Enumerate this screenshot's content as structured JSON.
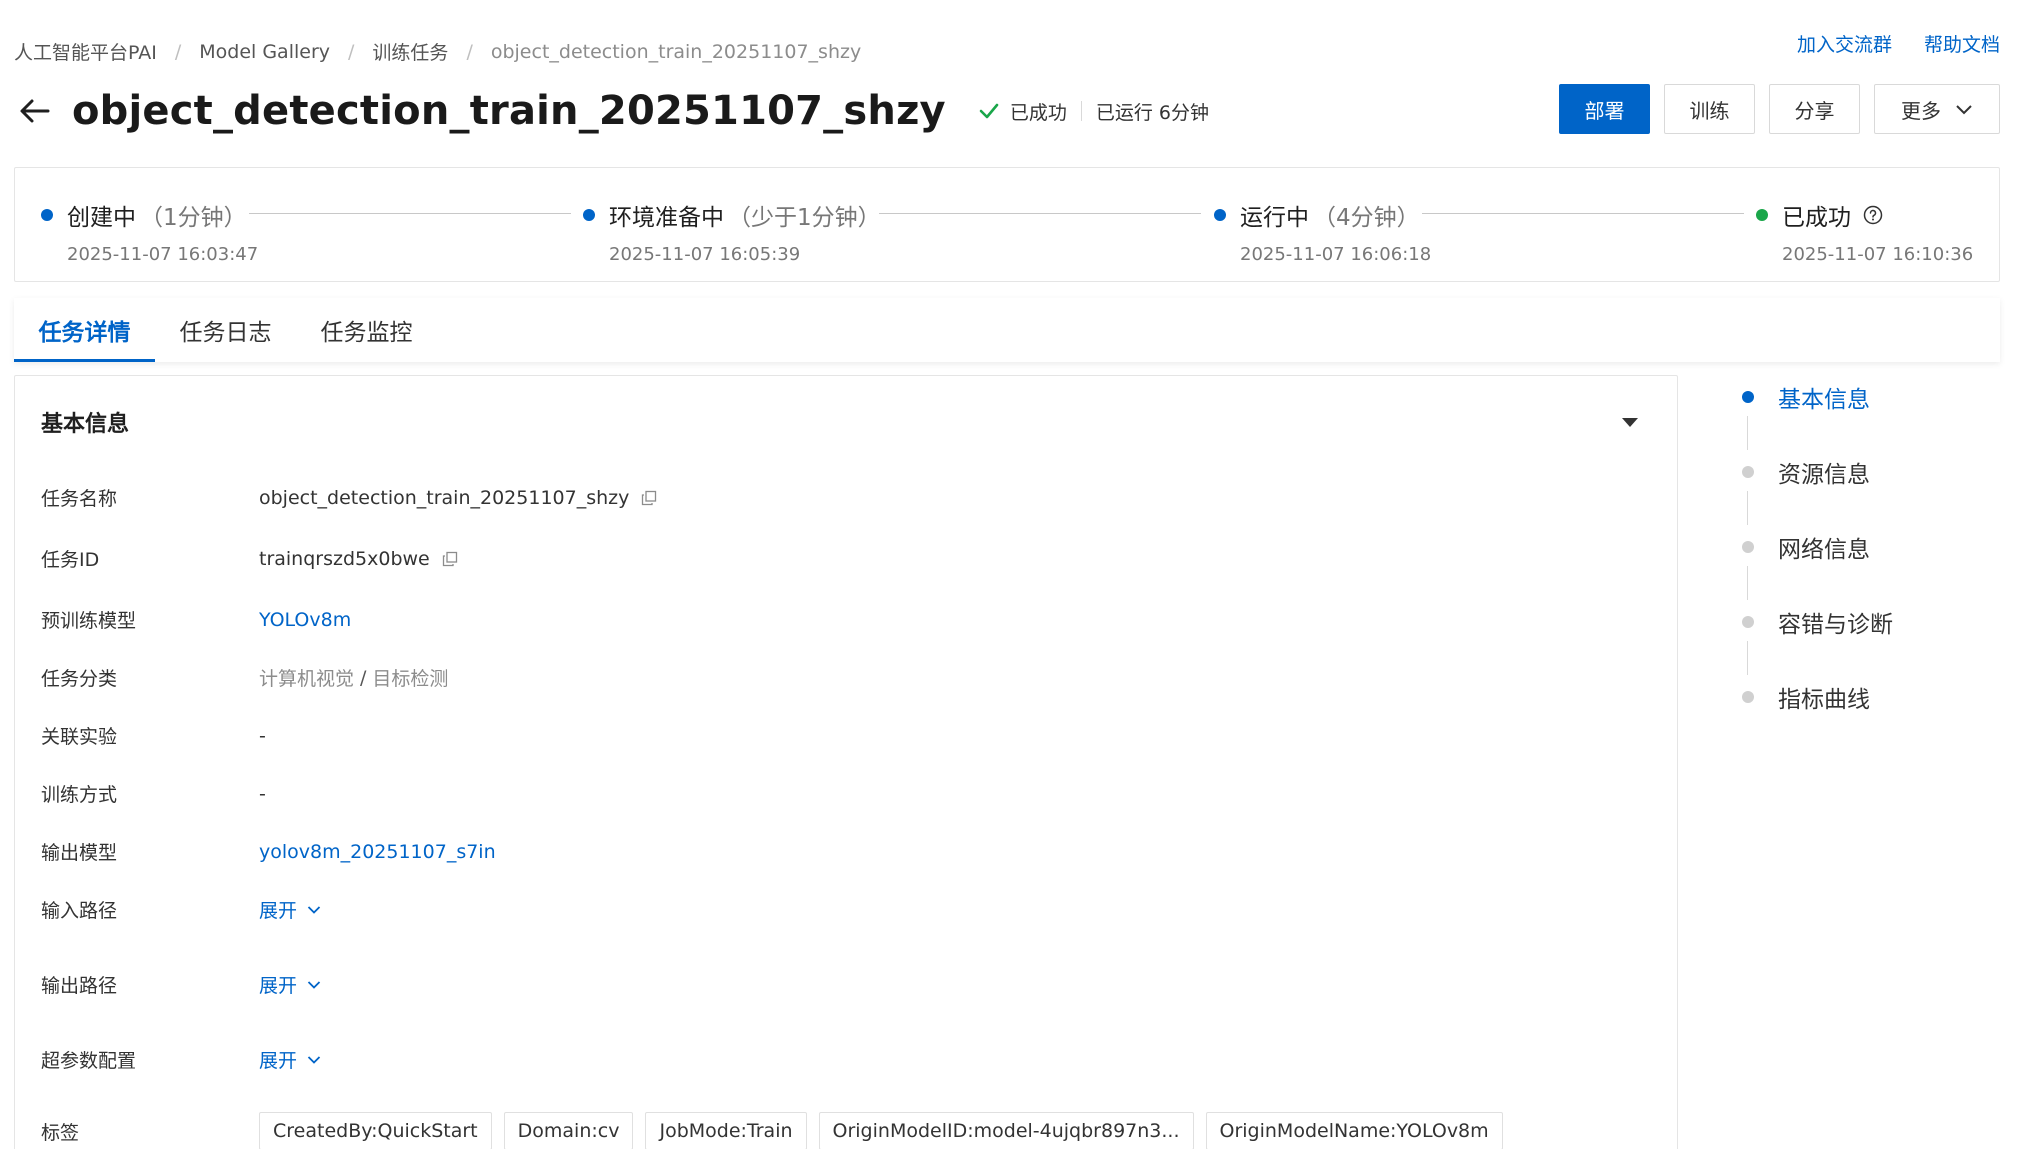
{
  "breadcrumb": [
    "人工智能平台PAI",
    "Model Gallery",
    "训练任务",
    "object_detection_train_20251107_shzy"
  ],
  "top_links": {
    "join_group": "加入交流群",
    "help_docs": "帮助文档"
  },
  "title": "object_detection_train_20251107_shzy",
  "status": {
    "state": "已成功",
    "runtime": "已运行 6分钟",
    "color": "#1aa64a"
  },
  "actions": {
    "deploy": "部署",
    "train": "训练",
    "share": "分享",
    "more": "更多"
  },
  "timeline": [
    {
      "name": "创建中",
      "duration": "（1分钟）",
      "time": "2025-11-07 16:03:47",
      "color": "#0064c8"
    },
    {
      "name": "环境准备中",
      "duration": "（少于1分钟）",
      "time": "2025-11-07 16:05:39",
      "color": "#0064c8"
    },
    {
      "name": "运行中",
      "duration": "（4分钟）",
      "time": "2025-11-07 16:06:18",
      "color": "#0064c8"
    },
    {
      "name": "已成功",
      "duration": "",
      "time": "2025-11-07 16:10:36",
      "color": "#1aa64a"
    }
  ],
  "tabs": [
    "任务详情",
    "任务日志",
    "任务监控"
  ],
  "basic_info": {
    "section_title": "基本信息",
    "fields": {
      "task_name": {
        "label": "任务名称",
        "value": "object_detection_train_20251107_shzy"
      },
      "task_id": {
        "label": "任务ID",
        "value": "trainqrszd5x0bwe"
      },
      "pretrained_model": {
        "label": "预训练模型",
        "value": "YOLOv8m"
      },
      "task_category": {
        "label": "任务分类",
        "value_1": "计算机视觉",
        "separator": "/",
        "value_2": "目标检测"
      },
      "related_experiment": {
        "label": "关联实验",
        "value": "-"
      },
      "training_method": {
        "label": "训练方式",
        "value": "-"
      },
      "output_model": {
        "label": "输出模型",
        "value": "yolov8m_20251107_s7in"
      },
      "input_path": {
        "label": "输入路径",
        "value": "展开"
      },
      "output_path": {
        "label": "输出路径",
        "value": "展开"
      },
      "hyperparams": {
        "label": "超参数配置",
        "value": "展开"
      },
      "tags": {
        "label": "标签",
        "items": [
          "CreatedBy:QuickStart",
          "Domain:cv",
          "JobMode:Train",
          "OriginModelID:model-4ujqbr897n3...",
          "OriginModelName:YOLOv8m"
        ]
      }
    }
  },
  "anchor_nav": [
    "基本信息",
    "资源信息",
    "网络信息",
    "容错与诊断",
    "指标曲线"
  ],
  "colors": {
    "accent": "#0064c8",
    "success": "#1aa64a"
  }
}
